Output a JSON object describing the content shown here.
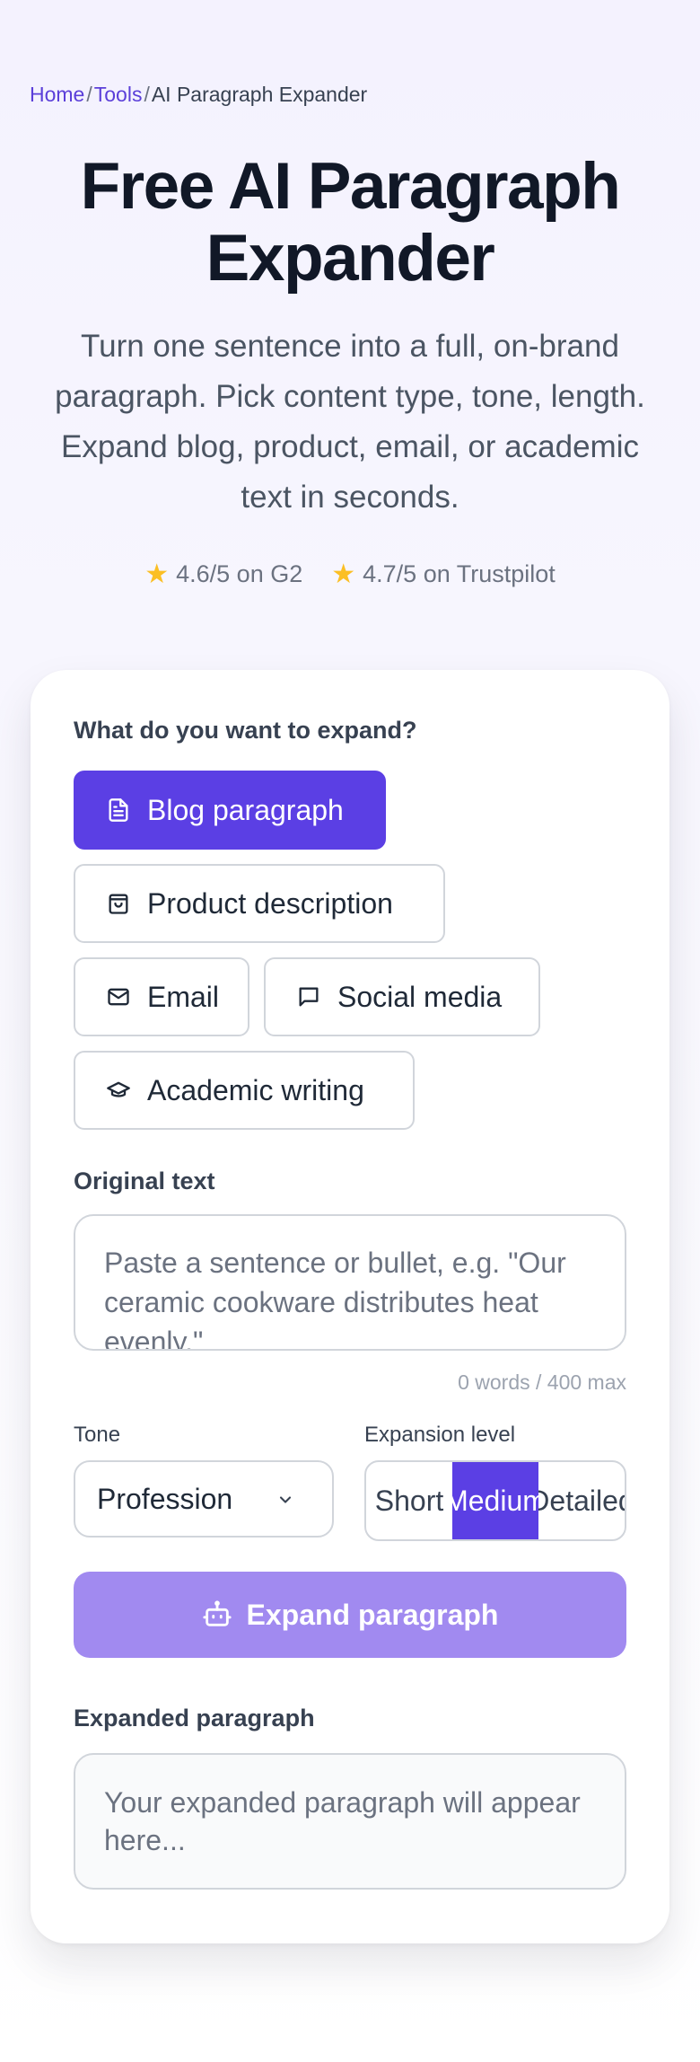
{
  "breadcrumb": {
    "home": "Home",
    "tools": "Tools",
    "current": "AI Paragraph Expander",
    "separator": "/"
  },
  "hero": {
    "title": "Free AI Paragraph Expander",
    "subtitle": "Turn one sentence into a full, on-brand paragraph. Pick content type, tone, length. Expand blog, product, email, or academic text in seconds."
  },
  "ratings": [
    {
      "icon": "star-icon",
      "text": "4.6/5 on G2"
    },
    {
      "icon": "star-icon",
      "text": "4.7/5 on Trustpilot"
    }
  ],
  "form": {
    "content_type_label": "What do you want to expand?",
    "content_types": [
      {
        "label": "Blog paragraph",
        "icon": "document-icon",
        "selected": true
      },
      {
        "label": "Product description",
        "icon": "shopping-bag-icon",
        "selected": false
      },
      {
        "label": "Email",
        "icon": "mail-icon",
        "selected": false
      },
      {
        "label": "Social media",
        "icon": "chat-bubble-icon",
        "selected": false
      },
      {
        "label": "Academic writing",
        "icon": "graduation-cap-icon",
        "selected": false
      }
    ],
    "original_text_label": "Original text",
    "original_text_placeholder": "Paste a sentence or bullet, e.g. \"Our ceramic cookware distributes heat evenly.\"",
    "original_text_value": "",
    "word_counter": "0 words / 400 max",
    "tone_label": "Tone",
    "tone_value": "Profession",
    "expansion_label": "Expansion level",
    "expansion_options": [
      "Short",
      "Medium",
      "Detailed"
    ],
    "expansion_selected": "Medium",
    "expand_button": "Expand paragraph",
    "output_label": "Expanded paragraph",
    "output_placeholder": "Your expanded paragraph will appear here..."
  },
  "colors": {
    "accent": "#5b3fe4",
    "accent_disabled": "#a18af0",
    "star": "#fbbf24"
  }
}
